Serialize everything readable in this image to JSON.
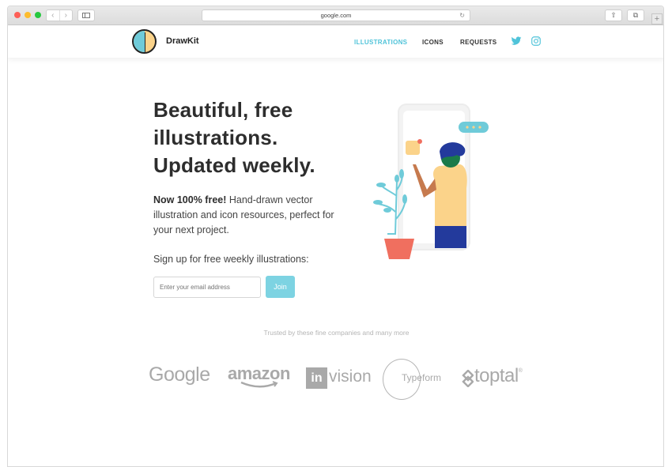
{
  "browser": {
    "url": "google.com",
    "back_icon": "chevron-left-icon",
    "forward_icon": "chevron-right-icon",
    "reload_icon": "reload-icon",
    "share_icon": "share-icon",
    "tabs_icon": "tabs-icon",
    "new_tab_label": "+"
  },
  "header": {
    "brand": "DrawKit",
    "nav": [
      {
        "label": "ILLUSTRATIONS",
        "active": true
      },
      {
        "label": "ICONS",
        "active": false
      },
      {
        "label": "REQUESTS",
        "active": false
      }
    ],
    "social_icons": [
      "twitter-icon",
      "instagram-icon"
    ]
  },
  "hero": {
    "title_lines": [
      "Beautiful, free",
      "illustrations.",
      "Updated weekly."
    ],
    "desc_bold": "Now 100% free!",
    "desc_rest": " Hand-drawn vector illustration and icon resources, perfect for your next project.",
    "signup_label": "Sign up for free weekly illustrations:",
    "email_placeholder": "Enter your email address",
    "join_label": "Join"
  },
  "trusted": {
    "label": "Trusted by these fine companies and many more",
    "companies": [
      "Google",
      "amazon",
      "vision",
      "Typeform",
      "toptal"
    ],
    "invision_mark": "in",
    "toptal_trademark": "®"
  },
  "colors": {
    "accent": "#4fc3d9",
    "join_bg": "#7dd3e2",
    "title": "#2d2d2d"
  }
}
